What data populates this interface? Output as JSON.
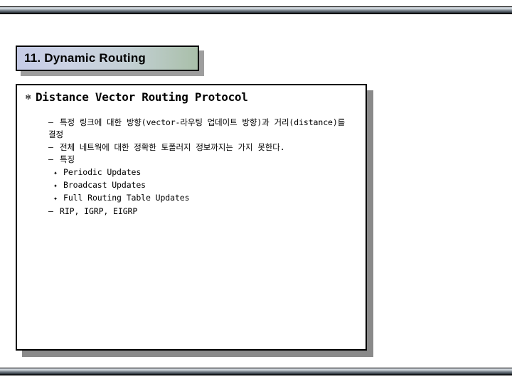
{
  "slide": {
    "title": "11. Dynamic Routing",
    "heading": {
      "bullet": "✻",
      "text": "Distance Vector Routing Protocol"
    },
    "bullets": [
      {
        "marker": "–",
        "level": "dash",
        "text": "특정 링크에 대한 방향(vector-라우팅 업데이트 방향)과 거리(distance)를"
      },
      {
        "marker": "",
        "level": "continuation",
        "text": "결정"
      },
      {
        "marker": "–",
        "level": "dash",
        "text": "전체 네트웍에 대한 정확한 토폴러지 정보까지는 가지 못한다."
      },
      {
        "marker": "–",
        "level": "dash",
        "text": "특징"
      },
      {
        "marker": "✦",
        "level": "flower",
        "text": "Periodic Updates"
      },
      {
        "marker": "✦",
        "level": "flower",
        "text": "Broadcast Updates"
      },
      {
        "marker": "✦",
        "level": "flower",
        "text": "Full Routing Table Updates"
      },
      {
        "marker": "–",
        "level": "dash",
        "text": "RIP, IGRP, EIGRP"
      }
    ]
  },
  "decor": {
    "top_rule": "",
    "bottom_rule": ""
  }
}
